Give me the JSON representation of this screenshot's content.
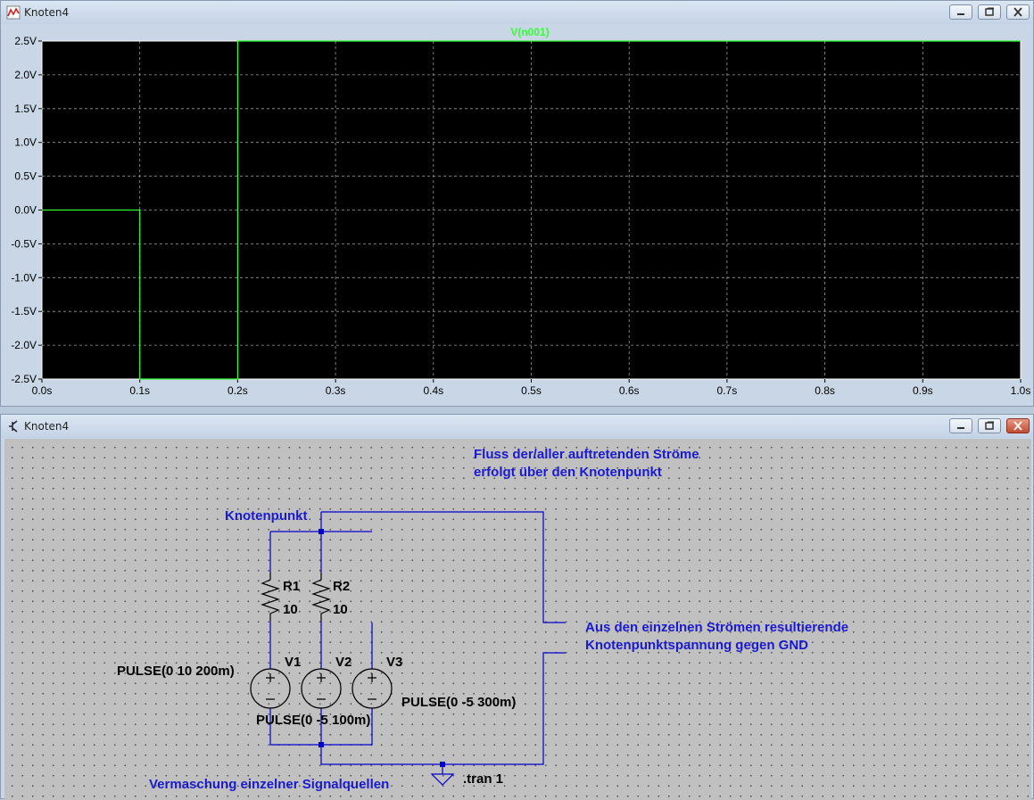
{
  "plot_window": {
    "title": "Knoten4",
    "trace_label": "V(n001)",
    "y_ticks": [
      "2.5V",
      "2.0V",
      "1.5V",
      "1.0V",
      "0.5V",
      "0.0V",
      "-0.5V",
      "-1.0V",
      "-1.5V",
      "-2.0V",
      "-2.5V"
    ],
    "x_ticks": [
      "0.0s",
      "0.1s",
      "0.2s",
      "0.3s",
      "0.4s",
      "0.5s",
      "0.6s",
      "0.7s",
      "0.8s",
      "0.9s",
      "1.0s"
    ]
  },
  "chart_data": {
    "type": "line",
    "series": [
      {
        "name": "V(n001)",
        "x": [
          0,
          0.1,
          0.1,
          0.2,
          0.2,
          1.0
        ],
        "y": [
          0,
          0,
          -2.5,
          -2.5,
          2.5,
          2.5
        ]
      }
    ],
    "xlim": [
      0,
      1.0
    ],
    "ylim": [
      -2.5,
      2.5
    ],
    "grid": true,
    "colors": {
      "trace": "#33ff33",
      "background": "#000000",
      "grid": "#9a9a9a",
      "axis": "#ffffff"
    }
  },
  "schematic_window": {
    "title": "Knoten4",
    "note_top_line1": "Fluss der/aller auftretenden Ströme",
    "note_top_line2": "erfolgt über den Knotenpunkt",
    "node_label": "Knotenpunkt",
    "note_right_line1": "Aus den einzelnen Strömen resultierende",
    "note_right_line2": "Knotenpunktspannung gegen GND",
    "r1_name": "R1",
    "r1_value": "10",
    "r2_name": "R2",
    "r2_value": "10",
    "v1_name": "V1",
    "v2_name": "V2",
    "v3_name": "V3",
    "v1_value": "PULSE(0 10 200m)",
    "v2_value": "PULSE(0 -5 100m)",
    "v3_value": "PULSE(0 -5 300m)",
    "directive": ".tran 1",
    "note_bottom_line1": "Vermaschung einzelner Signalquellen"
  },
  "colors": {
    "schematic_wire": "#0000cc",
    "annotation_text": "#1a1ad0",
    "schematic_bg": "#c0c0c0"
  }
}
